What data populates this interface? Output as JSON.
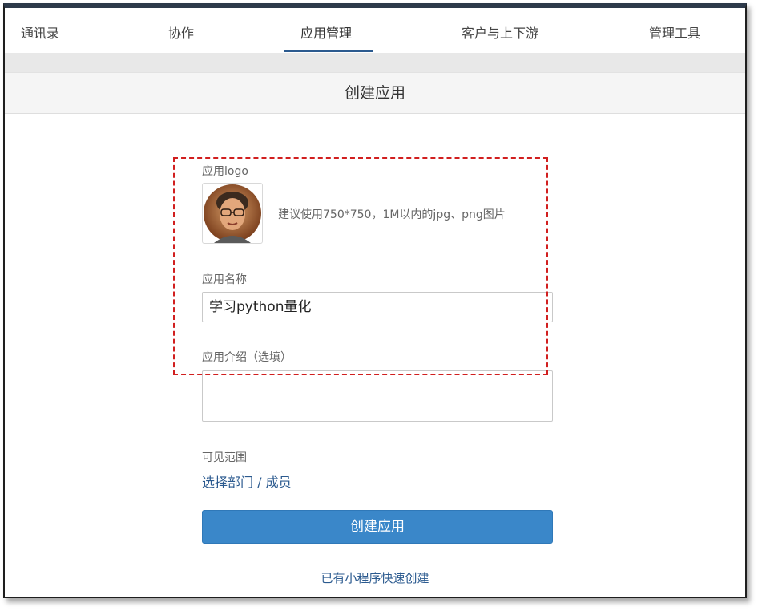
{
  "nav": {
    "tabs": [
      {
        "label": "通讯录"
      },
      {
        "label": "协作"
      },
      {
        "label": "应用管理"
      },
      {
        "label": "客户与上下游"
      },
      {
        "label": "管理工具"
      }
    ],
    "active_tab": "应用管理"
  },
  "page": {
    "title": "创建应用"
  },
  "form": {
    "logo_label": "应用logo",
    "logo_hint": "建议使用750*750，1M以内的jpg、png图片",
    "name_label": "应用名称",
    "name_value": "学习python量化",
    "desc_label": "应用介绍（选填）",
    "desc_value": "",
    "visibility_label": "可见范围",
    "visibility_link": "选择部门 / 成员",
    "create_button": "创建应用",
    "mini_program_link": "已有小程序快速创建"
  },
  "colors": {
    "accent": "#2b5a8f",
    "button": "#3a87c9",
    "highlight_box": "#d11f1f"
  }
}
